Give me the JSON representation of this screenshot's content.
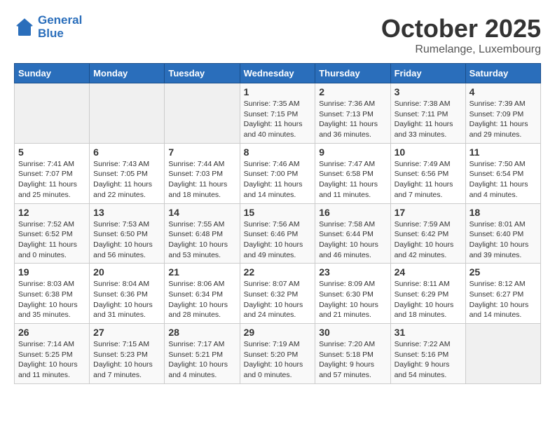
{
  "logo": {
    "line1": "General",
    "line2": "Blue"
  },
  "title": "October 2025",
  "subtitle": "Rumelange, Luxembourg",
  "weekdays": [
    "Sunday",
    "Monday",
    "Tuesday",
    "Wednesday",
    "Thursday",
    "Friday",
    "Saturday"
  ],
  "weeks": [
    [
      {
        "day": "",
        "info": ""
      },
      {
        "day": "",
        "info": ""
      },
      {
        "day": "",
        "info": ""
      },
      {
        "day": "1",
        "info": "Sunrise: 7:35 AM\nSunset: 7:15 PM\nDaylight: 11 hours\nand 40 minutes."
      },
      {
        "day": "2",
        "info": "Sunrise: 7:36 AM\nSunset: 7:13 PM\nDaylight: 11 hours\nand 36 minutes."
      },
      {
        "day": "3",
        "info": "Sunrise: 7:38 AM\nSunset: 7:11 PM\nDaylight: 11 hours\nand 33 minutes."
      },
      {
        "day": "4",
        "info": "Sunrise: 7:39 AM\nSunset: 7:09 PM\nDaylight: 11 hours\nand 29 minutes."
      }
    ],
    [
      {
        "day": "5",
        "info": "Sunrise: 7:41 AM\nSunset: 7:07 PM\nDaylight: 11 hours\nand 25 minutes."
      },
      {
        "day": "6",
        "info": "Sunrise: 7:43 AM\nSunset: 7:05 PM\nDaylight: 11 hours\nand 22 minutes."
      },
      {
        "day": "7",
        "info": "Sunrise: 7:44 AM\nSunset: 7:03 PM\nDaylight: 11 hours\nand 18 minutes."
      },
      {
        "day": "8",
        "info": "Sunrise: 7:46 AM\nSunset: 7:00 PM\nDaylight: 11 hours\nand 14 minutes."
      },
      {
        "day": "9",
        "info": "Sunrise: 7:47 AM\nSunset: 6:58 PM\nDaylight: 11 hours\nand 11 minutes."
      },
      {
        "day": "10",
        "info": "Sunrise: 7:49 AM\nSunset: 6:56 PM\nDaylight: 11 hours\nand 7 minutes."
      },
      {
        "day": "11",
        "info": "Sunrise: 7:50 AM\nSunset: 6:54 PM\nDaylight: 11 hours\nand 4 minutes."
      }
    ],
    [
      {
        "day": "12",
        "info": "Sunrise: 7:52 AM\nSunset: 6:52 PM\nDaylight: 11 hours\nand 0 minutes."
      },
      {
        "day": "13",
        "info": "Sunrise: 7:53 AM\nSunset: 6:50 PM\nDaylight: 10 hours\nand 56 minutes."
      },
      {
        "day": "14",
        "info": "Sunrise: 7:55 AM\nSunset: 6:48 PM\nDaylight: 10 hours\nand 53 minutes."
      },
      {
        "day": "15",
        "info": "Sunrise: 7:56 AM\nSunset: 6:46 PM\nDaylight: 10 hours\nand 49 minutes."
      },
      {
        "day": "16",
        "info": "Sunrise: 7:58 AM\nSunset: 6:44 PM\nDaylight: 10 hours\nand 46 minutes."
      },
      {
        "day": "17",
        "info": "Sunrise: 7:59 AM\nSunset: 6:42 PM\nDaylight: 10 hours\nand 42 minutes."
      },
      {
        "day": "18",
        "info": "Sunrise: 8:01 AM\nSunset: 6:40 PM\nDaylight: 10 hours\nand 39 minutes."
      }
    ],
    [
      {
        "day": "19",
        "info": "Sunrise: 8:03 AM\nSunset: 6:38 PM\nDaylight: 10 hours\nand 35 minutes."
      },
      {
        "day": "20",
        "info": "Sunrise: 8:04 AM\nSunset: 6:36 PM\nDaylight: 10 hours\nand 31 minutes."
      },
      {
        "day": "21",
        "info": "Sunrise: 8:06 AM\nSunset: 6:34 PM\nDaylight: 10 hours\nand 28 minutes."
      },
      {
        "day": "22",
        "info": "Sunrise: 8:07 AM\nSunset: 6:32 PM\nDaylight: 10 hours\nand 24 minutes."
      },
      {
        "day": "23",
        "info": "Sunrise: 8:09 AM\nSunset: 6:30 PM\nDaylight: 10 hours\nand 21 minutes."
      },
      {
        "day": "24",
        "info": "Sunrise: 8:11 AM\nSunset: 6:29 PM\nDaylight: 10 hours\nand 18 minutes."
      },
      {
        "day": "25",
        "info": "Sunrise: 8:12 AM\nSunset: 6:27 PM\nDaylight: 10 hours\nand 14 minutes."
      }
    ],
    [
      {
        "day": "26",
        "info": "Sunrise: 7:14 AM\nSunset: 5:25 PM\nDaylight: 10 hours\nand 11 minutes."
      },
      {
        "day": "27",
        "info": "Sunrise: 7:15 AM\nSunset: 5:23 PM\nDaylight: 10 hours\nand 7 minutes."
      },
      {
        "day": "28",
        "info": "Sunrise: 7:17 AM\nSunset: 5:21 PM\nDaylight: 10 hours\nand 4 minutes."
      },
      {
        "day": "29",
        "info": "Sunrise: 7:19 AM\nSunset: 5:20 PM\nDaylight: 10 hours\nand 0 minutes."
      },
      {
        "day": "30",
        "info": "Sunrise: 7:20 AM\nSunset: 5:18 PM\nDaylight: 9 hours\nand 57 minutes."
      },
      {
        "day": "31",
        "info": "Sunrise: 7:22 AM\nSunset: 5:16 PM\nDaylight: 9 hours\nand 54 minutes."
      },
      {
        "day": "",
        "info": ""
      }
    ]
  ]
}
